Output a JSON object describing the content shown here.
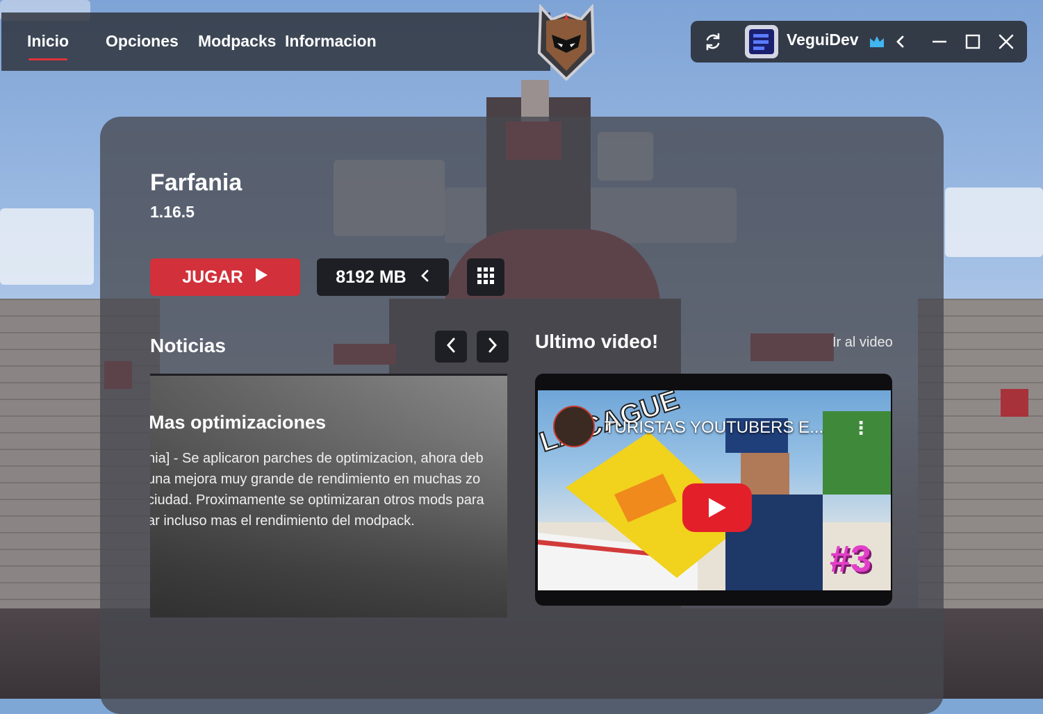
{
  "nav": {
    "items": [
      "Inicio",
      "Opciones",
      "Modpacks",
      "Informacion"
    ],
    "active": "Inicio"
  },
  "account": {
    "username": "VeguiDev",
    "icons": [
      "refresh-icon",
      "crown-icon",
      "chevron-left-icon",
      "minimize-icon",
      "maximize-icon",
      "close-icon"
    ]
  },
  "modpack": {
    "name": "Farfania",
    "version": "1.16.5",
    "play_label": "JUGAR",
    "ram_label": "8192 MB"
  },
  "news": {
    "section_title": "Noticias",
    "title": "Mas optimizaciones",
    "lines": [
      "nia] - Se aplicaron parches de optimizacion, ahora deb",
      "una mejora muy grande de rendimiento en muchas zo",
      "ciudad. Proximamente se optimizaran otros mods para",
      "ar incluso mas el rendimiento del modpack."
    ]
  },
  "video": {
    "section_title": "Ultimo video!",
    "link_label": "Ir al video",
    "title": "TURISTAS YOUTUBERS E...",
    "overlay_text": "LA CAGUE",
    "episode": "#3"
  },
  "colors": {
    "accent": "#d2303a",
    "button_dark": "#1e1f24",
    "crown": "#3fb6f0"
  }
}
